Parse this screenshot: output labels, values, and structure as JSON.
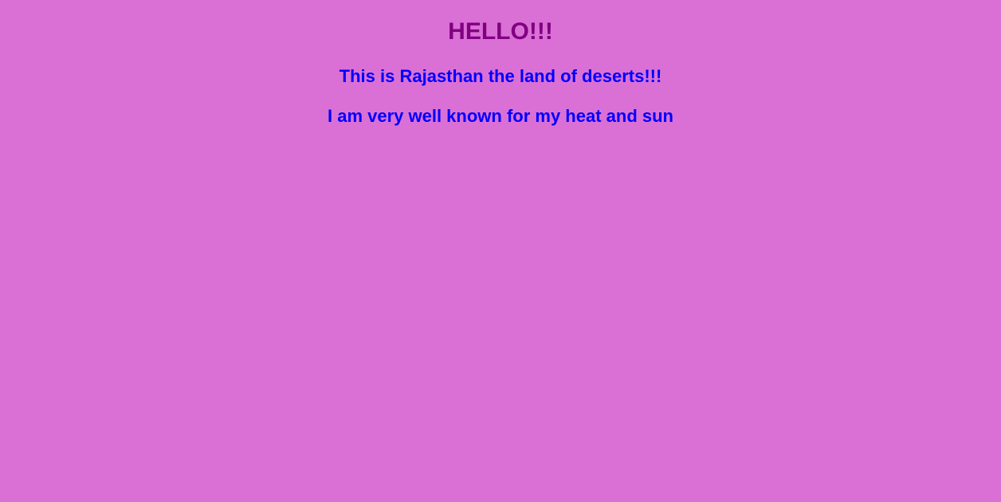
{
  "page": {
    "background_color": "#da70d6"
  },
  "greeting": {
    "text": "HELLO!!!",
    "color": "#800080"
  },
  "intro": {
    "line1": "This is Rajasthan the land of deserts!!!",
    "line2": "I am very well known for my heat and sun",
    "color": "#0000ff"
  }
}
